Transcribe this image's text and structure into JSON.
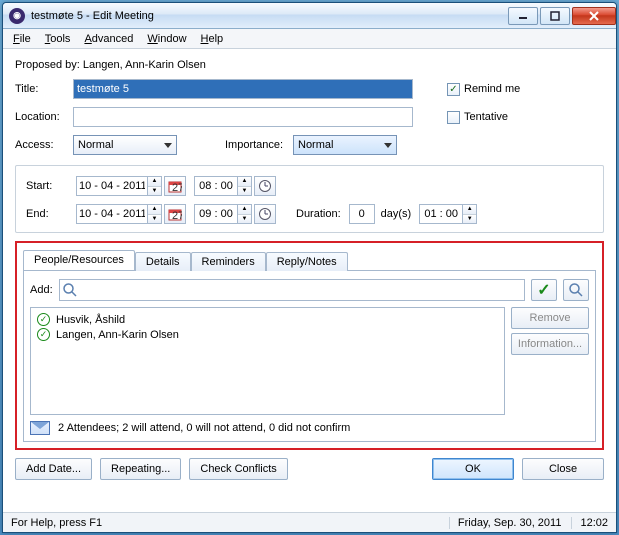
{
  "window": {
    "title": "testmøte 5 - Edit Meeting"
  },
  "menu": {
    "file": "File",
    "tools": "Tools",
    "advanced": "Advanced",
    "window": "Window",
    "help": "Help"
  },
  "proposed_by_label": "Proposed by:",
  "proposed_by_value": "Langen, Ann-Karin Olsen",
  "labels": {
    "title": "Title:",
    "location": "Location:",
    "access": "Access:",
    "importance": "Importance:",
    "start": "Start:",
    "end": "End:",
    "duration": "Duration:",
    "days": "day(s)",
    "add": "Add:"
  },
  "fields": {
    "title_value": "testmøte 5",
    "location_value": "",
    "access_value": "Normal",
    "importance_value": "Normal",
    "start_date": "10 - 04 - 2011",
    "start_time": "08 : 00",
    "end_date": "10 - 04 - 2011",
    "end_time": "09 : 00",
    "duration_days": "0",
    "duration_time": "01 : 00"
  },
  "right": {
    "remind_label": "Remind me",
    "remind_checked": "✓",
    "tentative_label": "Tentative"
  },
  "tabs": {
    "people": "People/Resources",
    "details": "Details",
    "reminders": "Reminders",
    "reply": "Reply/Notes"
  },
  "side": {
    "remove": "Remove",
    "info": "Information..."
  },
  "attendees": [
    {
      "name": "Husvik, Åshild"
    },
    {
      "name": "Langen, Ann-Karin Olsen"
    }
  ],
  "att_summary": "2 Attendees; 2 will attend, 0 will not attend, 0 did not confirm",
  "bottom": {
    "add_date": "Add Date...",
    "repeating": "Repeating...",
    "check_conflicts": "Check Conflicts",
    "ok": "OK",
    "close": "Close"
  },
  "status": {
    "help": "For Help, press F1",
    "date": "Friday, Sep. 30, 2011",
    "time": "12:02"
  }
}
